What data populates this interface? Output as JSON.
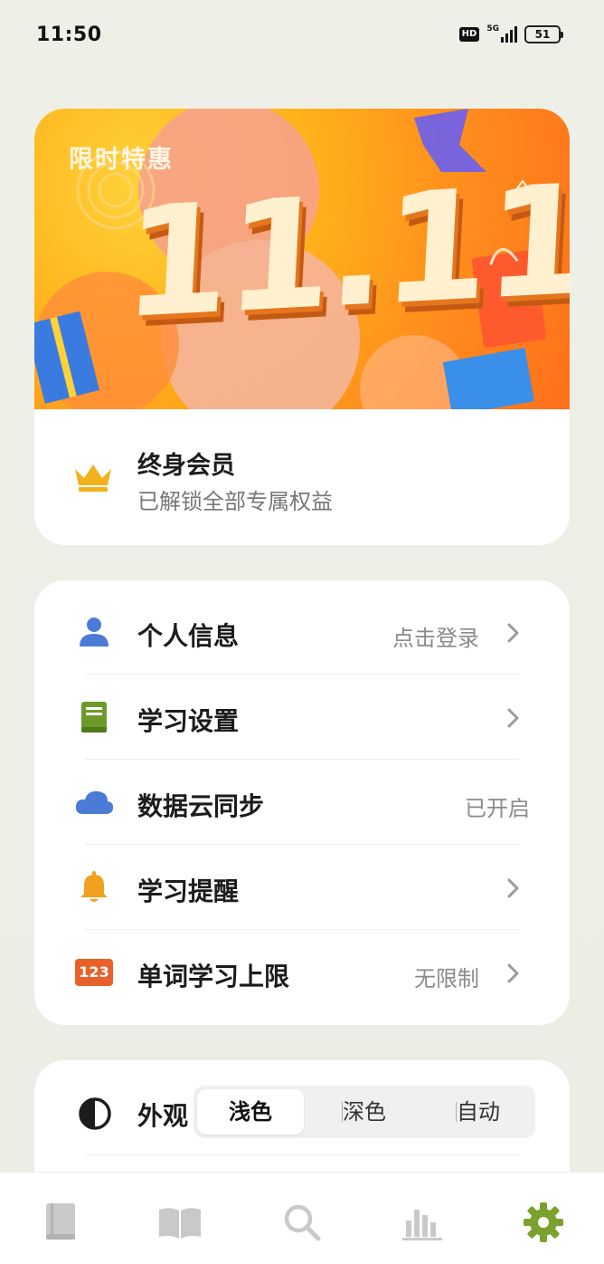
{
  "status_bar": {
    "time": "11:50",
    "hd": "HD",
    "network": "5G",
    "battery": "51"
  },
  "promo": {
    "tag": "限时特惠",
    "headline": "11.11",
    "member_title": "终身会员",
    "member_subtitle": "已解锁全部专属权益",
    "crown_color": "#f3b21c"
  },
  "settings": {
    "items": [
      {
        "label": "个人信息",
        "value": "点击登录",
        "icon": "person-icon",
        "color": "#4a7bd6",
        "chevron": true
      },
      {
        "label": "学习设置",
        "value": "",
        "icon": "book-icon",
        "color": "#6b9a2a",
        "chevron": true
      },
      {
        "label": "数据云同步",
        "value": "已开启",
        "icon": "cloud-icon",
        "color": "#4a7bd6",
        "chevron": false
      },
      {
        "label": "学习提醒",
        "value": "",
        "icon": "bell-icon",
        "color": "#f2a11f",
        "chevron": true
      },
      {
        "label": "单词学习上限",
        "value": "无限制",
        "icon": "numbers-icon",
        "icon_text": "123",
        "color": "#e8612a",
        "chevron": true
      }
    ]
  },
  "appearance": {
    "label": "外观",
    "options": [
      "浅色",
      "深色",
      "自动"
    ],
    "selected": "浅色"
  },
  "tabbar": {
    "tabs": [
      {
        "icon": "wordbook-icon",
        "active": false
      },
      {
        "icon": "open-book-icon",
        "active": false
      },
      {
        "icon": "search-icon",
        "active": false
      },
      {
        "icon": "stats-icon",
        "active": false
      },
      {
        "icon": "gear-icon",
        "active": true
      }
    ],
    "active_color": "#7ba22e",
    "inactive_color": "#c9c9c9"
  }
}
